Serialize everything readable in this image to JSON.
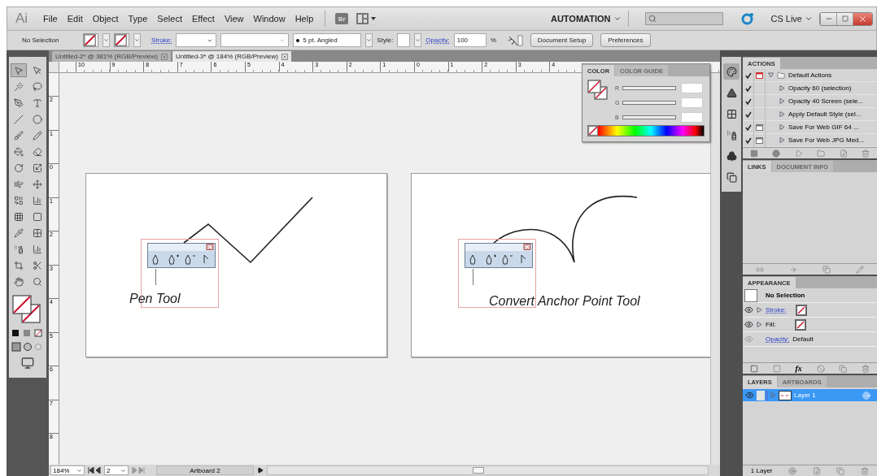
{
  "menubar": {
    "logo": "Ai",
    "menus": [
      "File",
      "Edit",
      "Object",
      "Type",
      "Select",
      "Effect",
      "View",
      "Window",
      "Help"
    ],
    "bridge": "Br",
    "workspace": "AUTOMATION",
    "cs_live": "CS Live"
  },
  "control_bar": {
    "selection": "No Selection",
    "stroke_label": "Stroke:",
    "brush": "5 pt. Angled",
    "style_label": "Style:",
    "opacity_label": "Opacity:",
    "opacity": "100",
    "percent": "%",
    "buttons": [
      "Document Setup",
      "Preferences"
    ]
  },
  "tabs": [
    {
      "label": "Untitled-2* @ 381% (RGB/Preview)",
      "selected": false
    },
    {
      "label": "Untitled-3* @ 184% (RGB/Preview)",
      "selected": true
    }
  ],
  "rulers": {
    "horizontal": [
      "10",
      "9",
      "8",
      "7",
      "6",
      "5",
      "4",
      "3",
      "2",
      "1",
      "0",
      "1",
      "2",
      "3",
      "4"
    ],
    "vertical": [
      "2",
      "1",
      "0",
      "1",
      "2",
      "3",
      "4",
      "5",
      "6",
      "7",
      "8"
    ]
  },
  "artboards": [
    {
      "kind": "zigzag",
      "caption": "Pen Tool"
    },
    {
      "kind": "curve",
      "caption": "Convert Anchor Point Tool"
    }
  ],
  "color_panel": {
    "tabs": [
      {
        "label": "COLOR",
        "selected": true
      },
      {
        "label": "COLOR GUIDE",
        "selected": false
      }
    ],
    "channels": [
      "R",
      "G",
      "B"
    ]
  },
  "actions_panel": {
    "tabs": [
      {
        "label": "ACTIONS",
        "selected": true
      }
    ],
    "set": {
      "name": "Default Actions",
      "checked": true,
      "dialog": true,
      "expanded": true
    },
    "items": [
      {
        "name": "Opacity 60 (selection)",
        "checked": true,
        "dialog": false,
        "expanded": false
      },
      {
        "name": "Opacity 40 Screen (sele...",
        "checked": true,
        "dialog": false,
        "expanded": false
      },
      {
        "name": "Apply Default Style (sel...",
        "checked": true,
        "dialog": false,
        "expanded": false
      },
      {
        "name": "Save For Web GIF 64 ...",
        "checked": true,
        "dialog": true,
        "expanded": false
      },
      {
        "name": "Save For Web JPG Med...",
        "checked": true,
        "dialog": true,
        "expanded": false
      }
    ]
  },
  "links_panel": {
    "tabs": [
      {
        "label": "LINKS",
        "selected": true
      },
      {
        "label": "DOCUMENT INFO",
        "selected": false
      }
    ]
  },
  "appearance_panel": {
    "tabs": [
      {
        "label": "APPEARANCE",
        "selected": true
      }
    ],
    "selection": "No Selection",
    "rows": [
      {
        "kind": "swatch",
        "label": "Stroke:",
        "link": true
      },
      {
        "kind": "swatch",
        "label": "Fill:",
        "link": false
      },
      {
        "kind": "value",
        "label": "Opacity:",
        "link": true,
        "value": "Default"
      }
    ],
    "fx": "fx"
  },
  "layers_panel": {
    "tabs": [
      {
        "label": "LAYERS",
        "selected": true
      },
      {
        "label": "ARTBOARDS",
        "selected": false
      }
    ],
    "layers": [
      {
        "name": "Layer 1",
        "selected": true
      }
    ],
    "count": "1 Layer"
  },
  "status_bar": {
    "zoom": "184%",
    "artboard_number": "2",
    "artboard_name": "Artboard 2"
  }
}
